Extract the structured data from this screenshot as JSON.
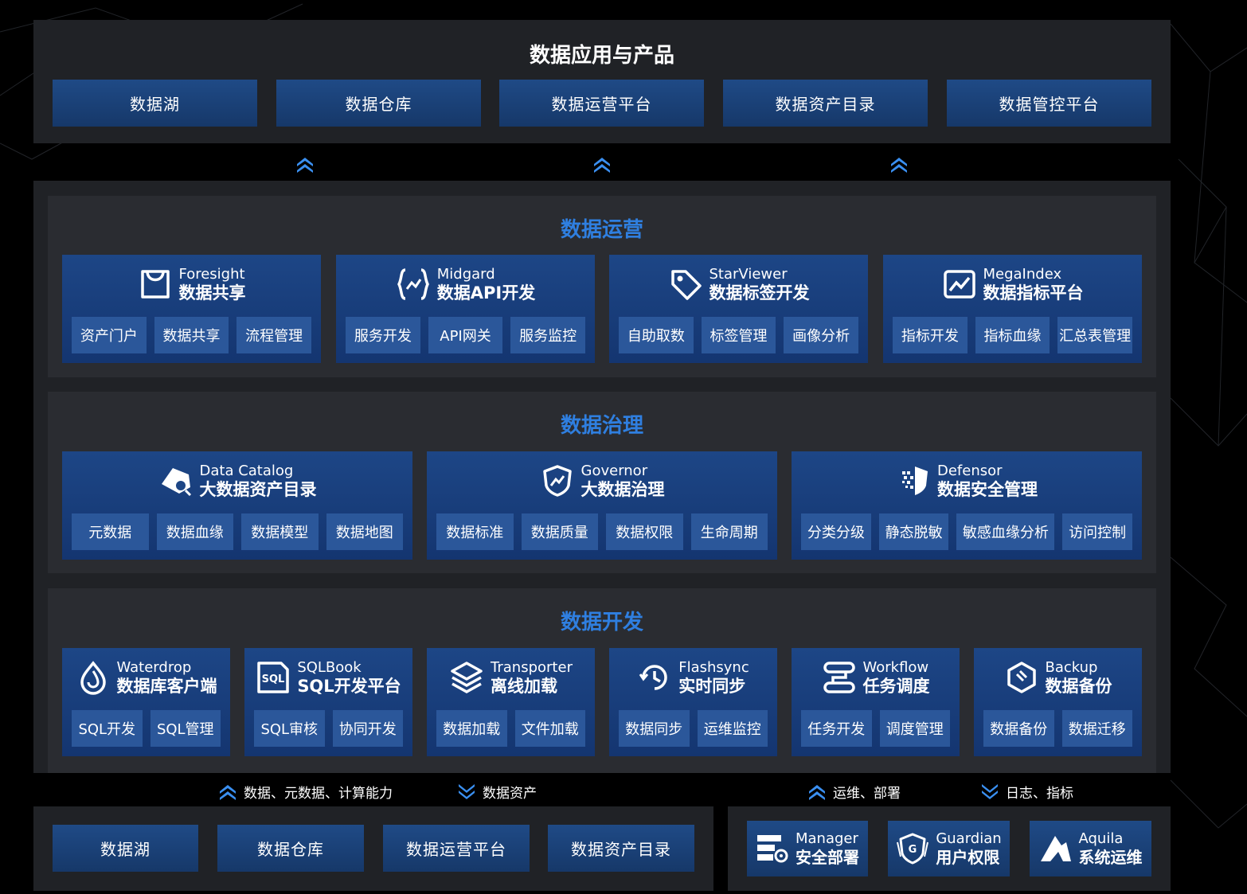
{
  "top": {
    "title": "数据应用与产品",
    "items": [
      "数据湖",
      "数据仓库",
      "数据运营平台",
      "数据资产目录",
      "数据管控平台"
    ]
  },
  "sections": {
    "ops": {
      "title": "数据运营",
      "cards": [
        {
          "en": "Foresight",
          "zh": "数据共享",
          "icon": "bag-icon",
          "subs": [
            "资产门户",
            "数据共享",
            "流程管理"
          ]
        },
        {
          "en": "Midgard",
          "zh": "数据API开发",
          "icon": "api-icon",
          "subs": [
            "服务开发",
            "API网关",
            "服务监控"
          ]
        },
        {
          "en": "StarViewer",
          "zh": "数据标签开发",
          "icon": "tag-icon",
          "subs": [
            "自助取数",
            "标签管理",
            "画像分析"
          ]
        },
        {
          "en": "MegaIndex",
          "zh": "数据指标平台",
          "icon": "trend-chart-icon",
          "subs": [
            "指标开发",
            "指标血缘",
            "汇总表管理"
          ]
        }
      ]
    },
    "gov": {
      "title": "数据治理",
      "cards": [
        {
          "en": "Data Catalog",
          "zh": "大数据资产目录",
          "icon": "catalog-icon",
          "subs": [
            "元数据",
            "数据血缘",
            "数据模型",
            "数据地图"
          ]
        },
        {
          "en": "Governor",
          "zh": "大数据治理",
          "icon": "shield-trend-icon",
          "subs": [
            "数据标准",
            "数据质量",
            "数据权限",
            "生命周期"
          ]
        },
        {
          "en": "Defensor",
          "zh": "数据安全管理",
          "icon": "security-shield-icon",
          "subs": [
            "分类分级",
            "静态脱敏",
            "敏感血缘分析",
            "访问控制"
          ]
        }
      ]
    },
    "dev": {
      "title": "数据开发",
      "cards": [
        {
          "en": "Waterdrop",
          "zh": "数据库客户端",
          "icon": "waterdrop-icon",
          "subs": [
            "SQL开发",
            "SQL管理"
          ]
        },
        {
          "en": "SQLBook",
          "zh": "SQL开发平台",
          "icon": "sql-icon",
          "subs": [
            "SQL审核",
            "协同开发"
          ]
        },
        {
          "en": "Transporter",
          "zh": "离线加载",
          "icon": "layers-icon",
          "subs": [
            "数据加载",
            "文件加载"
          ]
        },
        {
          "en": "Flashsync",
          "zh": "实时同步",
          "icon": "sync-clock-icon",
          "subs": [
            "数据同步",
            "运维监控"
          ]
        },
        {
          "en": "Workflow",
          "zh": "任务调度",
          "icon": "workflow-icon",
          "subs": [
            "任务开发",
            "调度管理"
          ]
        },
        {
          "en": "Backup",
          "zh": "数据备份",
          "icon": "backup-icon",
          "subs": [
            "数据备份",
            "数据迁移"
          ]
        }
      ]
    }
  },
  "flows": {
    "left_up": "数据、元数据、计算能力",
    "left_down": "数据资产",
    "right_up": "运维、部署",
    "right_down": "日志、指标"
  },
  "bottom": {
    "items": [
      "数据湖",
      "数据仓库",
      "数据运营平台",
      "数据资产目录"
    ],
    "tools": [
      {
        "en": "Manager",
        "zh": "安全部署",
        "icon": "server-gear-icon"
      },
      {
        "en": "Guardian",
        "zh": "用户权限",
        "icon": "guardian-shield-icon"
      },
      {
        "en": "Aquila",
        "zh": "系统运维",
        "icon": "aquila-logo-icon"
      }
    ]
  },
  "colors": {
    "accent": "#2f7fe0",
    "card": "#1d4686",
    "sub": "#2b579a",
    "panel": "#202226"
  }
}
